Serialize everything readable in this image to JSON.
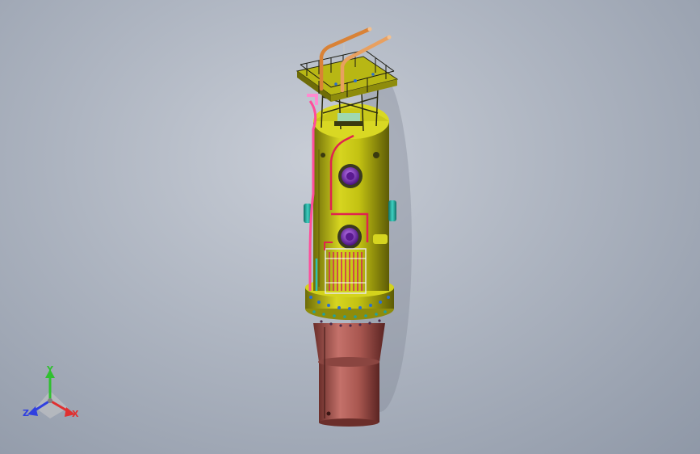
{
  "viewport": {
    "background_top": "#c8cdd6",
    "background_bottom": "#8f98a7"
  },
  "model": {
    "body_color": "#c3c212",
    "skirt_color": "#b0605a",
    "piping_colors": [
      "#e0224f",
      "#d98236",
      "#ff66cc"
    ],
    "nozzle_color": "#7b2bc4",
    "side_nozzle_color": "#23b3a3"
  },
  "triad": {
    "x_label": "X",
    "y_label": "Y",
    "z_label": "Z",
    "x_color": "#e03030",
    "y_color": "#30c030",
    "z_color": "#3040e0"
  }
}
